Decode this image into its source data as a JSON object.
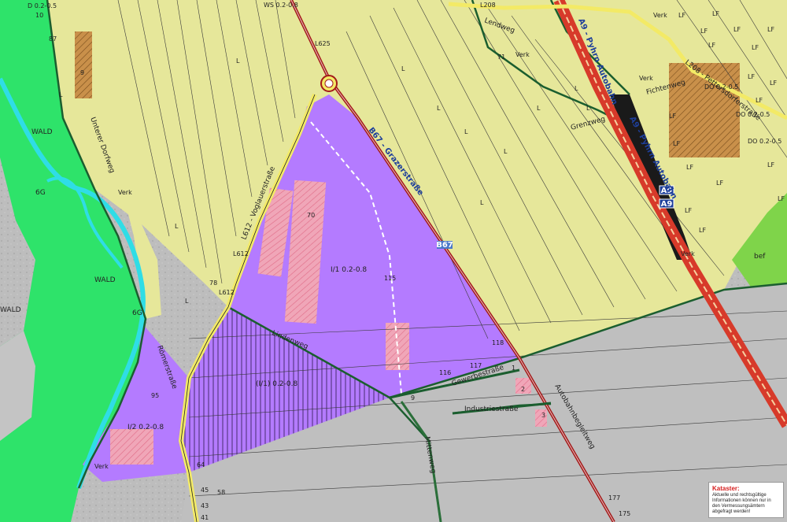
{
  "roads": {
    "a9_upper": "A9 - Pyhrn Autobahn",
    "a9_middle": "A9 - Pyhrn Autobahn",
    "a9_shield_1": "A9",
    "a9_shield_2": "A9",
    "l612": "L612 - Voglauerstraße",
    "l612_code": "L612",
    "l612_code_2": "L612",
    "l625": "L625",
    "l208_top": "L208",
    "l208_east": "L208 - Pettersdorferstraße",
    "b67": "B67 - Grazerstraße",
    "b67_code": "B67",
    "unterer_dorfweg": "Unterer Dorfweg",
    "romerstrasse": "Römerstraße",
    "gewerbestrasse": "Gewerbestraße",
    "industriestrasse": "Industriestraße",
    "mittenweg": "Mittenweg",
    "autobahnbegleitweg": "Autobahnbegleitweg",
    "fichtenweg": "Fichtenweg",
    "grenzweg": "Grenzweg",
    "lendweg": "Lendweg",
    "lindenweg": "Lindenweg"
  },
  "zones": {
    "wald_1": "WALD",
    "wald_2": "WALD",
    "wald_3": "WALD",
    "gi_main": "I/1 0.2-0.8",
    "gi_hatched": "(I/1) 0.2-0.8",
    "gi_south": "I/2 0.2-0.8",
    "ortsgebiet_sw": "G",
    "ortsgebiet_w": "6G",
    "ortsgebiet_w2": "6G",
    "top_ws": "WS 0.2-0.8",
    "top_left": "D 0.2-0.5",
    "do_1": "DO 0.2-0.5",
    "do_2": "DO 0.2-0.5",
    "do_3": "DO 0.2-0.5",
    "bef": "bef"
  },
  "verk": [
    "Verk",
    "Verk",
    "Verk",
    "Verk",
    "Verk",
    "Verk"
  ],
  "landuse_l": [
    "L",
    "L",
    "L",
    "L",
    "L",
    "L",
    "L",
    "L",
    "L",
    "L",
    "L",
    "L"
  ],
  "landuse_lf": [
    "LF",
    "LF",
    "LF",
    "LF",
    "LF",
    "LF",
    "LF",
    "LF",
    "LF",
    "LF",
    "LF",
    "LF",
    "LF",
    "LF",
    "LF",
    "LF",
    "LF",
    "LF"
  ],
  "parcels": [
    "10",
    "87",
    "9",
    "78",
    "70",
    "115",
    "118",
    "117",
    "116",
    "95",
    "64",
    "45",
    "58",
    "43",
    "41",
    "177",
    "175",
    "2",
    "3",
    "1",
    "9",
    "71"
  ],
  "legend": {
    "title": "Kataster:",
    "text": "Aktuelle und rechtsgültige Informationen können nur in den Vermessungsämtern abgefragt werden!"
  },
  "colors": {
    "agricultural": "#e6e79a",
    "forest": "#2ee36a",
    "industrial": "#b47bff",
    "built_land": "#bdbdbd",
    "water": "#2fdde6",
    "highway": "#d73a2a",
    "main_road": "#a31a1a",
    "cadastre_line": "#333333",
    "boundary": "#1b5e2f"
  }
}
